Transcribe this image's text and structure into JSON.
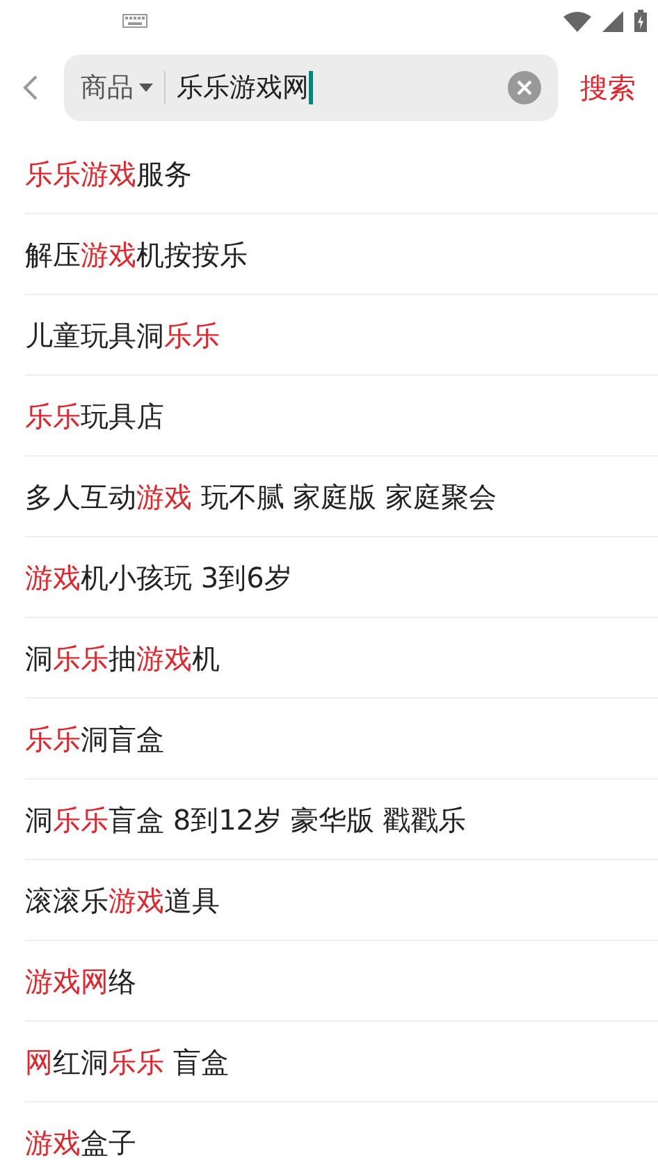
{
  "search_bar": {
    "category": "商品",
    "value": "乐乐游戏网",
    "search_button": "搜索"
  },
  "suggestions": [
    {
      "segments": [
        {
          "text": "乐乐游戏",
          "highlight": true
        },
        {
          "text": "服务",
          "highlight": false
        }
      ]
    },
    {
      "segments": [
        {
          "text": "解压",
          "highlight": false
        },
        {
          "text": "游戏",
          "highlight": true
        },
        {
          "text": "机按按乐",
          "highlight": false
        }
      ]
    },
    {
      "segments": [
        {
          "text": "儿童玩具洞",
          "highlight": false
        },
        {
          "text": "乐乐",
          "highlight": true
        }
      ]
    },
    {
      "segments": [
        {
          "text": "乐乐",
          "highlight": true
        },
        {
          "text": "玩具店",
          "highlight": false
        }
      ]
    },
    {
      "segments": [
        {
          "text": "多人互动",
          "highlight": false
        },
        {
          "text": "游戏",
          "highlight": true
        },
        {
          "text": " 玩不腻 家庭版 家庭聚会",
          "highlight": false
        }
      ]
    },
    {
      "segments": [
        {
          "text": "游戏",
          "highlight": true
        },
        {
          "text": "机小孩玩 3到6岁",
          "highlight": false
        }
      ]
    },
    {
      "segments": [
        {
          "text": "洞",
          "highlight": false
        },
        {
          "text": "乐乐",
          "highlight": true
        },
        {
          "text": "抽",
          "highlight": false
        },
        {
          "text": "游戏",
          "highlight": true
        },
        {
          "text": "机",
          "highlight": false
        }
      ]
    },
    {
      "segments": [
        {
          "text": "乐乐",
          "highlight": true
        },
        {
          "text": "洞盲盒",
          "highlight": false
        }
      ]
    },
    {
      "segments": [
        {
          "text": "洞",
          "highlight": false
        },
        {
          "text": "乐乐",
          "highlight": true
        },
        {
          "text": "盲盒 8到12岁 豪华版 戳戳乐",
          "highlight": false
        }
      ]
    },
    {
      "segments": [
        {
          "text": "滚滚乐",
          "highlight": false
        },
        {
          "text": "游戏",
          "highlight": true
        },
        {
          "text": "道具",
          "highlight": false
        }
      ]
    },
    {
      "segments": [
        {
          "text": "游戏网",
          "highlight": true
        },
        {
          "text": "络",
          "highlight": false
        }
      ]
    },
    {
      "segments": [
        {
          "text": "网",
          "highlight": true
        },
        {
          "text": "红洞",
          "highlight": false
        },
        {
          "text": "乐乐",
          "highlight": true
        },
        {
          "text": " 盲盒",
          "highlight": false
        }
      ]
    },
    {
      "segments": [
        {
          "text": "游戏",
          "highlight": true
        },
        {
          "text": "盒子",
          "highlight": false
        }
      ]
    }
  ]
}
